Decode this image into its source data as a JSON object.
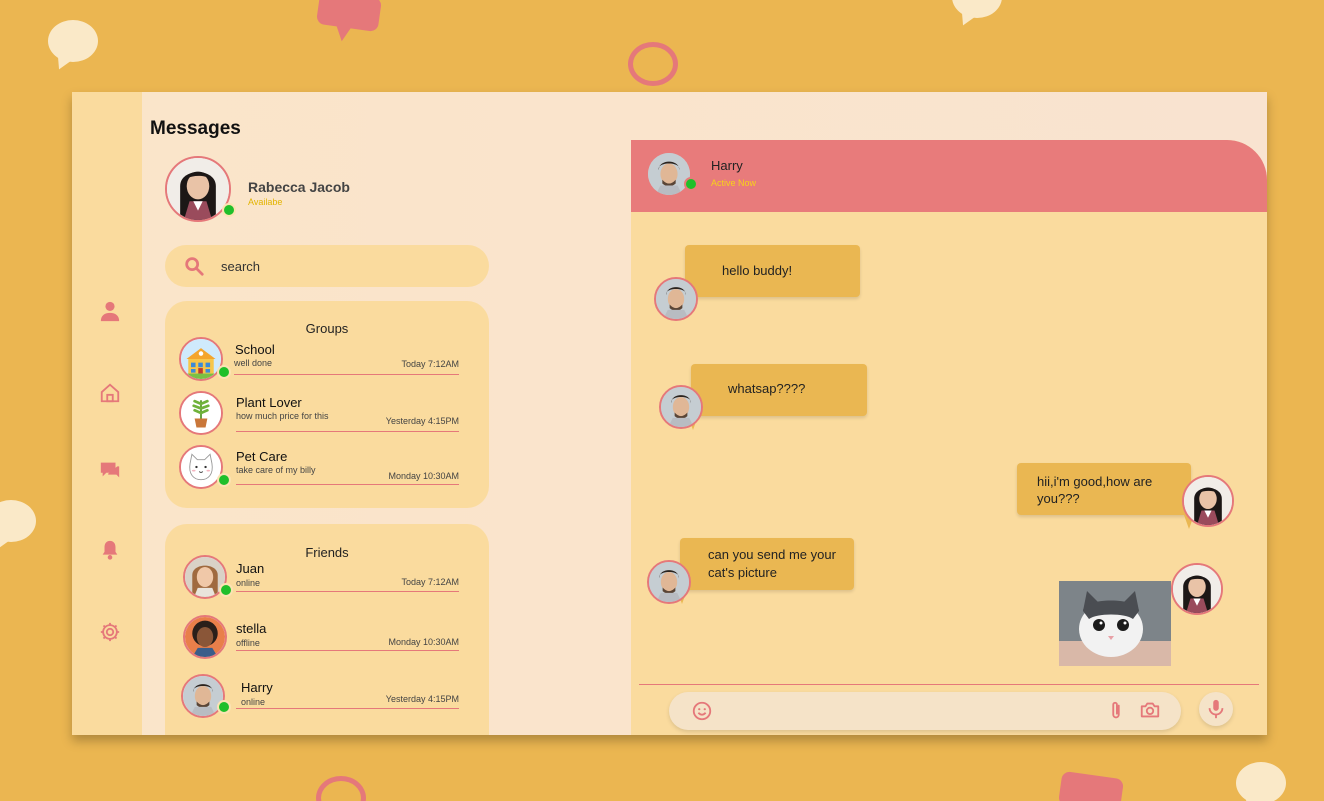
{
  "colors": {
    "background": "#ebb651",
    "accent": "#e5787a",
    "header": "#e87b7b",
    "panel": "#fadb9e",
    "bubble": "#eab752",
    "online": "#1fbf2a",
    "status_text": "#e3b400"
  },
  "page_title": "Messages",
  "profile": {
    "name": "Rabecca Jacob",
    "status": "Availabe"
  },
  "search": {
    "placeholder": "search"
  },
  "sidebar": {
    "icons": [
      "user-icon",
      "home-icon",
      "messages-icon",
      "bell-icon",
      "settings-icon"
    ]
  },
  "groups": {
    "title": "Groups",
    "items": [
      {
        "name": "School",
        "preview": "well done",
        "time": "Today 7:12AM",
        "icon": "school-icon"
      },
      {
        "name": "Plant Lover",
        "preview": "how much price for this",
        "time": "Yesterday 4:15PM",
        "icon": "plant-icon"
      },
      {
        "name": "Pet Care",
        "preview": "take care of my billy",
        "time": "Monday 10:30AM",
        "icon": "cat-icon"
      }
    ]
  },
  "friends": {
    "title": "Friends",
    "items": [
      {
        "name": "Juan",
        "status": "online",
        "time": "Today 7:12AM"
      },
      {
        "name": "stella",
        "status": "offline",
        "time": "Monday 10:30AM"
      },
      {
        "name": "Harry",
        "status": "online",
        "time": "Yesterday 4:15PM"
      }
    ]
  },
  "chat": {
    "contact": {
      "name": "Harry",
      "status": "Active Now"
    },
    "messages": [
      {
        "from": "Harry",
        "text": "hello buddy!"
      },
      {
        "from": "Harry",
        "text": "whatsap????"
      },
      {
        "from": "me",
        "text": "hii,i'm good,how are you???"
      },
      {
        "from": "Harry",
        "text": "can you send me your cat's picture"
      },
      {
        "from": "me",
        "attachment": "kitten-photo"
      }
    ],
    "composer": {
      "placeholder": ""
    }
  }
}
